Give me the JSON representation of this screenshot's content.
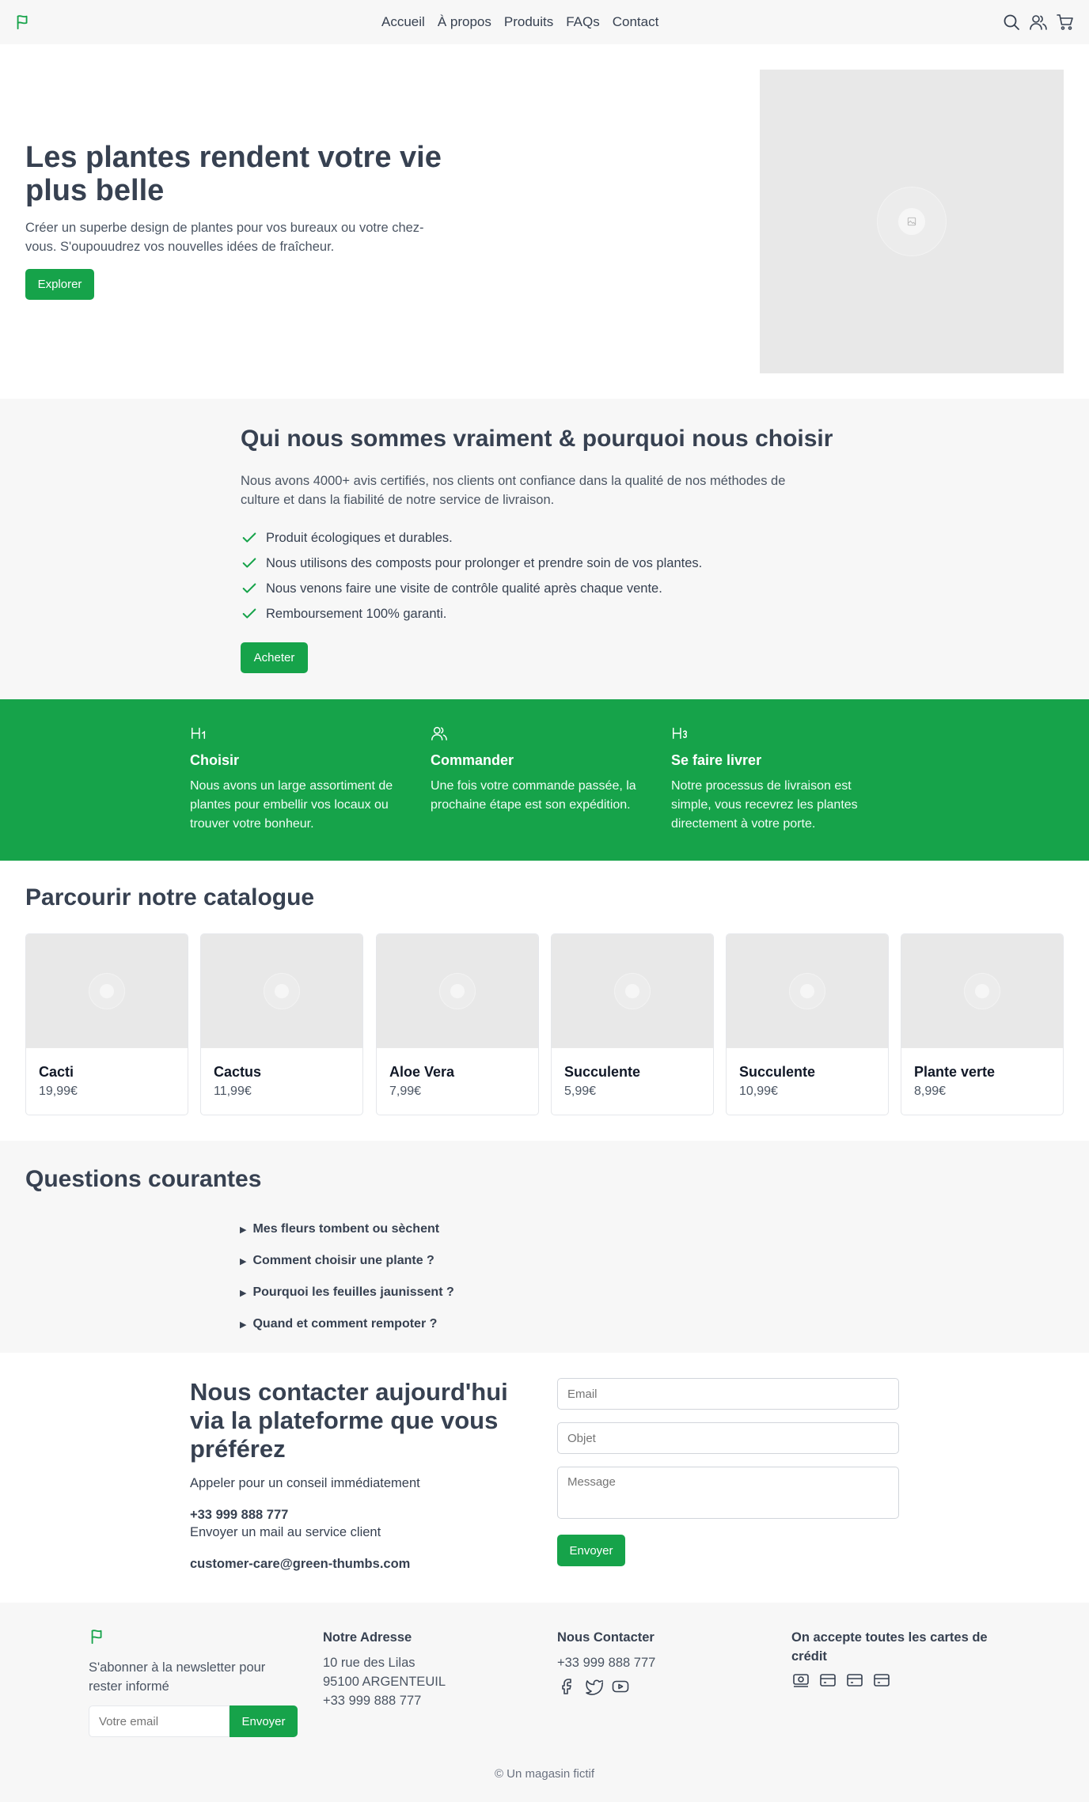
{
  "nav": {
    "links": [
      "Accueil",
      "À propos",
      "Produits",
      "FAQs",
      "Contact"
    ]
  },
  "hero": {
    "title": "Les plantes rendent votre vie plus belle",
    "subtitle": "Créer un superbe design de plantes pour vos bureaux ou votre chez-vous. S'oupouudrez vos nouvelles idées de fraîcheur.",
    "button": "Explorer"
  },
  "why": {
    "title": "Qui nous sommes vraiment & pourquoi nous choisir",
    "intro": "Nous avons 4000+ avis certifiés, nos clients ont confiance dans la qualité de nos méthodes de culture et dans la fiabilité de notre service de livraison.",
    "items": [
      "Produit écologiques et durables.",
      "Nous utilisons des composts pour prolonger et prendre soin de vos plantes.",
      "Nous venons faire une visite de contrôle qualité après chaque vente.",
      "Remboursement 100% garanti."
    ],
    "button": "Acheter"
  },
  "steps": [
    {
      "title": "Choisir",
      "text": "Nous avons un large assortiment de plantes pour embellir vos locaux ou trouver votre bonheur.",
      "icon": "heading-icon"
    },
    {
      "title": "Commander",
      "text": "Une fois votre commande passée, la prochaine étape est son expédition.",
      "icon": "users-icon"
    },
    {
      "title": "Se faire livrer",
      "text": "Notre processus de livraison est simple, vous recevrez les plantes directement à votre porte.",
      "icon": "heading-icon"
    }
  ],
  "catalog": {
    "title": "Parcourir notre catalogue",
    "products": [
      {
        "name": "Cacti",
        "price": "19,99€"
      },
      {
        "name": "Cactus",
        "price": "11,99€"
      },
      {
        "name": "Aloe Vera",
        "price": "7,99€"
      },
      {
        "name": "Succulente",
        "price": "5,99€"
      },
      {
        "name": "Succulente",
        "price": "10,99€"
      },
      {
        "name": "Plante verte",
        "price": "8,99€"
      }
    ]
  },
  "faq": {
    "title": "Questions courantes",
    "items": [
      "Mes fleurs tombent ou sèchent",
      "Comment choisir une plante ?",
      "Pourquoi les feuilles jaunissent ?",
      "Quand et comment rempoter ?"
    ]
  },
  "contact": {
    "title": "Nous contacter aujourd'hui via la plateforme que vous préférez",
    "call_text": "Appeler pour un conseil immédiatement",
    "phone": "+33 999 888 777",
    "mail_text": "Envoyer un mail au service client",
    "email": "customer-care@green-thumbs.com",
    "form": {
      "email_placeholder": "Email",
      "subject_placeholder": "Objet",
      "message_placeholder": "Message",
      "button": "Envoyer"
    }
  },
  "footer": {
    "newsletter_text": "S'abonner à la newsletter pour rester informé",
    "newsletter_placeholder": "Votre email",
    "newsletter_button": "Envoyer",
    "address_title": "Notre Adresse",
    "address_line1": "10 rue des Lilas",
    "address_line2": "95100 ARGENTEUIL",
    "address_phone": "+33 999 888 777",
    "contact_title": "Nous Contacter",
    "contact_phone": "+33 999 888 777",
    "cards_title": "On accepte toutes les cartes de crédit",
    "copyright": "© Un magasin fictif"
  },
  "colors": {
    "accent": "#16a34a",
    "text": "#374151",
    "section_bg": "#f7f7f7",
    "placeholder_bg": "#e8e8e8"
  }
}
